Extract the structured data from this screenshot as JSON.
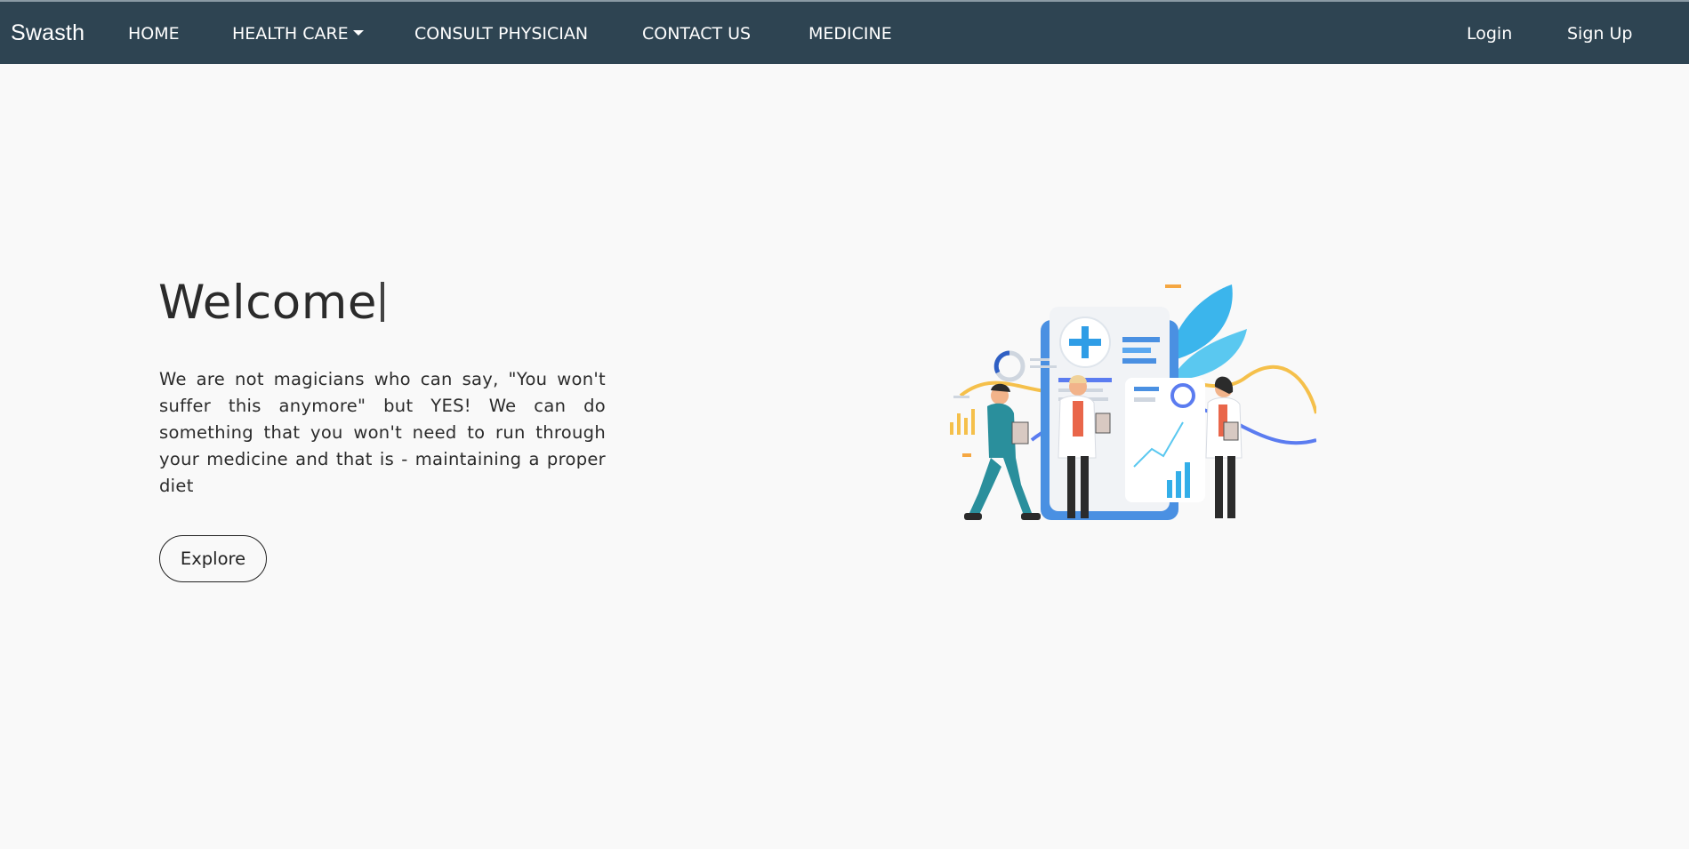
{
  "navbar": {
    "brand": "Swasth",
    "links": [
      {
        "label": "HOME"
      },
      {
        "label": "HEALTH CARE",
        "dropdown": true
      },
      {
        "label": "CONSULT PHYSICIAN"
      },
      {
        "label": "CONTACT US"
      },
      {
        "label": "MEDICINE"
      }
    ],
    "auth": {
      "login": "Login",
      "signup": "Sign Up"
    },
    "background_color": "#2e4452"
  },
  "hero": {
    "title": "Welcome",
    "text": "We are not magicians who can say, \"You won't suffer this anymore\" but YES! We can do something that you won't need to run through your medicine and that is - maintaining a proper diet",
    "button_label": "Explore"
  },
  "illustration": {
    "icon": "medical-team-illustration",
    "accent_colors": [
      "#4a90e2",
      "#33aee8",
      "#f5c04b",
      "#e9664a",
      "#2a8f9c"
    ]
  }
}
